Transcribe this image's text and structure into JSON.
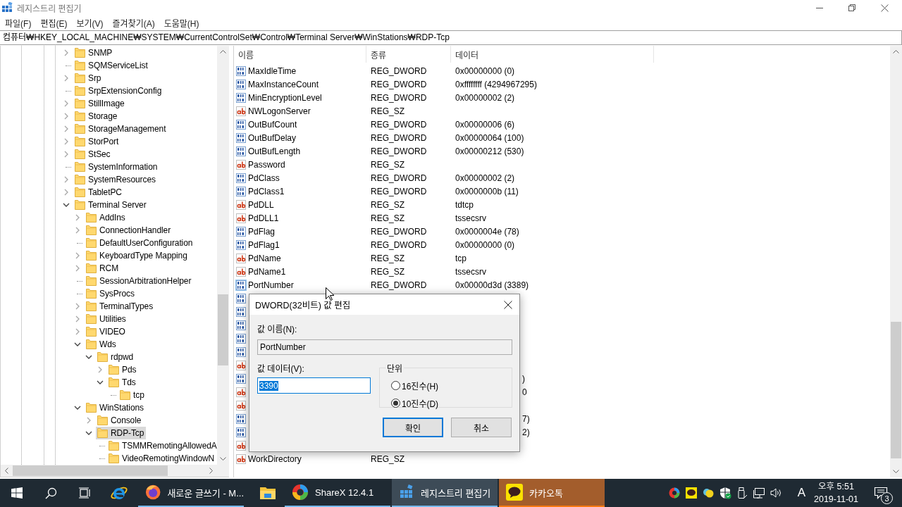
{
  "window": {
    "title": "레지스트리 편집기"
  },
  "menu": [
    "파일(F)",
    "편집(E)",
    "보기(V)",
    "즐겨찾기(A)",
    "도움말(H)"
  ],
  "address": "컴퓨터₩HKEY_LOCAL_MACHINE₩SYSTEM₩CurrentControlSet₩Control₩Terminal Server₩WinStations₩RDP-Tcp",
  "tree": [
    {
      "label": "SNMP",
      "kind": "branch",
      "expanded": false,
      "selected": false
    },
    {
      "label": "SQMServiceList",
      "kind": "leaf",
      "selected": false
    },
    {
      "label": "Srp",
      "kind": "branch",
      "expanded": false,
      "selected": false
    },
    {
      "label": "SrpExtensionConfig",
      "kind": "leaf",
      "selected": false
    },
    {
      "label": "StillImage",
      "kind": "branch",
      "expanded": false,
      "selected": false
    },
    {
      "label": "Storage",
      "kind": "branch",
      "expanded": false,
      "selected": false
    },
    {
      "label": "StorageManagement",
      "kind": "branch",
      "expanded": false,
      "selected": false
    },
    {
      "label": "StorPort",
      "kind": "branch",
      "expanded": false,
      "selected": false
    },
    {
      "label": "StSec",
      "kind": "branch",
      "expanded": false,
      "selected": false
    },
    {
      "label": "SystemInformation",
      "kind": "leaf",
      "selected": false
    },
    {
      "label": "SystemResources",
      "kind": "branch",
      "expanded": false,
      "selected": false
    },
    {
      "label": "TabletPC",
      "kind": "branch",
      "expanded": false,
      "selected": false
    },
    {
      "label": "Terminal Server",
      "kind": "branch",
      "expanded": true,
      "selected": false,
      "children": [
        {
          "label": "AddIns",
          "kind": "branch",
          "expanded": false,
          "selected": false
        },
        {
          "label": "ConnectionHandler",
          "kind": "branch",
          "expanded": false,
          "selected": false
        },
        {
          "label": "DefaultUserConfiguration",
          "kind": "leaf",
          "selected": false
        },
        {
          "label": "KeyboardType Mapping",
          "kind": "branch",
          "expanded": false,
          "selected": false
        },
        {
          "label": "RCM",
          "kind": "branch",
          "expanded": false,
          "selected": false
        },
        {
          "label": "SessionArbitrationHelper",
          "kind": "leaf",
          "selected": false
        },
        {
          "label": "SysProcs",
          "kind": "leaf",
          "selected": false
        },
        {
          "label": "TerminalTypes",
          "kind": "branch",
          "expanded": false,
          "selected": false
        },
        {
          "label": "Utilities",
          "kind": "branch",
          "expanded": false,
          "selected": false
        },
        {
          "label": "VIDEO",
          "kind": "branch",
          "expanded": false,
          "selected": false
        },
        {
          "label": "Wds",
          "kind": "branch",
          "expanded": true,
          "selected": false,
          "children": [
            {
              "label": "rdpwd",
              "kind": "branch",
              "expanded": true,
              "selected": false,
              "children": [
                {
                  "label": "Pds",
                  "kind": "branch",
                  "expanded": false,
                  "selected": false
                },
                {
                  "label": "Tds",
                  "kind": "branch",
                  "expanded": true,
                  "selected": false,
                  "children": [
                    {
                      "label": "tcp",
                      "kind": "leaf",
                      "selected": false
                    }
                  ]
                }
              ]
            }
          ]
        },
        {
          "label": "WinStations",
          "kind": "branch",
          "expanded": true,
          "selected": false,
          "children": [
            {
              "label": "Console",
              "kind": "branch",
              "expanded": false,
              "selected": false
            },
            {
              "label": "RDP-Tcp",
              "kind": "branch",
              "expanded": true,
              "selected": true,
              "children": [
                {
                  "label": "TSMMRemotingAllowedA",
                  "kind": "leaf",
                  "selected": false
                },
                {
                  "label": "VideoRemotingWindowN",
                  "kind": "leaf",
                  "selected": false
                }
              ]
            }
          ]
        }
      ]
    }
  ],
  "list": {
    "columns": [
      "이름",
      "종류",
      "데이터"
    ],
    "rows": [
      {
        "kind": "dword",
        "name": "MaxIdleTime",
        "type": "REG_DWORD",
        "data": "0x00000000 (0)",
        "selected": false
      },
      {
        "kind": "dword",
        "name": "MaxInstanceCount",
        "type": "REG_DWORD",
        "data": "0xffffffff (4294967295)",
        "selected": false
      },
      {
        "kind": "dword",
        "name": "MinEncryptionLevel",
        "type": "REG_DWORD",
        "data": "0x00000002 (2)",
        "selected": false
      },
      {
        "kind": "sz",
        "name": "NWLogonServer",
        "type": "REG_SZ",
        "selected": false
      },
      {
        "kind": "dword",
        "name": "OutBufCount",
        "type": "REG_DWORD",
        "data": "0x00000006 (6)",
        "selected": false
      },
      {
        "kind": "dword",
        "name": "OutBufDelay",
        "type": "REG_DWORD",
        "data": "0x00000064 (100)",
        "selected": false
      },
      {
        "kind": "dword",
        "name": "OutBufLength",
        "type": "REG_DWORD",
        "data": "0x00000212 (530)",
        "selected": false
      },
      {
        "kind": "sz",
        "name": "Password",
        "type": "REG_SZ",
        "selected": false
      },
      {
        "kind": "dword",
        "name": "PdClass",
        "type": "REG_DWORD",
        "data": "0x00000002 (2)",
        "selected": false
      },
      {
        "kind": "dword",
        "name": "PdClass1",
        "type": "REG_DWORD",
        "data": "0x0000000b (11)",
        "selected": false
      },
      {
        "kind": "sz",
        "name": "PdDLL",
        "type": "REG_SZ",
        "data": "tdtcp",
        "selected": false
      },
      {
        "kind": "sz",
        "name": "PdDLL1",
        "type": "REG_SZ",
        "data": "tssecsrv",
        "selected": false
      },
      {
        "kind": "dword",
        "name": "PdFlag",
        "type": "REG_DWORD",
        "data": "0x0000004e (78)",
        "selected": false
      },
      {
        "kind": "dword",
        "name": "PdFlag1",
        "type": "REG_DWORD",
        "data": "0x00000000 (0)",
        "selected": false
      },
      {
        "kind": "sz",
        "name": "PdName",
        "type": "REG_SZ",
        "data": "tcp",
        "selected": false
      },
      {
        "kind": "sz",
        "name": "PdName1",
        "type": "REG_SZ",
        "data": "tssecsrv",
        "selected": false
      },
      {
        "kind": "dword",
        "name": "PortNumber",
        "type": "REG_DWORD",
        "data": "0x00000d3d (3389)",
        "selected": true
      },
      {
        "kind": "dword",
        "selected": false
      },
      {
        "kind": "dword",
        "selected": false
      },
      {
        "kind": "dword",
        "selected": false
      },
      {
        "kind": "dword",
        "selected": false
      },
      {
        "kind": "dword",
        "selected": false
      },
      {
        "kind": "sz",
        "selected": false
      },
      {
        "kind": "dword",
        "data_tail": ")",
        "selected": false
      },
      {
        "kind": "sz",
        "data_tail": "0",
        "selected": false
      },
      {
        "kind": "sz",
        "selected": false
      },
      {
        "kind": "dword",
        "data_tail": "7)",
        "selected": false
      },
      {
        "kind": "dword",
        "data_tail": "2)",
        "selected": false
      },
      {
        "kind": "sz",
        "selected": false
      },
      {
        "kind": "sz",
        "name": "WorkDirectory",
        "type": "REG_SZ",
        "selected": false
      }
    ]
  },
  "dialog": {
    "title": "DWORD(32비트) 값 편집",
    "name_label": "값 이름(N):",
    "name_value": "PortNumber",
    "data_label": "값 데이터(V):",
    "data_value": "3390",
    "data_value_selected": true,
    "base_label": "단위",
    "base_options": [
      {
        "label": "16진수(H)",
        "selected": false
      },
      {
        "label": "10진수(D)",
        "selected": true
      }
    ],
    "buttons": [
      {
        "label": "확인",
        "default": true
      },
      {
        "label": "취소",
        "default": false
      }
    ]
  },
  "taskbar": {
    "items": [
      {
        "kind": "start"
      },
      {
        "kind": "search"
      },
      {
        "kind": "taskview"
      },
      {
        "kind": "ie",
        "running": false,
        "active": false,
        "attention": false
      },
      {
        "kind": "firefox",
        "label": "새로운 글쓰기 - M...",
        "running": true,
        "active": false,
        "attention": false
      },
      {
        "kind": "explorer",
        "running": false,
        "active": false,
        "attention": false
      },
      {
        "kind": "sharex",
        "label": "ShareX 12.4.1",
        "running": true,
        "active": false,
        "attention": false
      },
      {
        "kind": "regedit",
        "label": "레지스트리 편집기",
        "running": true,
        "active": true,
        "attention": false
      },
      {
        "kind": "kakao",
        "label": "카카오톡",
        "running": true,
        "active": false,
        "attention": true
      }
    ],
    "tray": [
      {
        "kind": "sharex"
      },
      {
        "kind": "kakao"
      },
      {
        "kind": "chat"
      },
      {
        "kind": "shield"
      },
      {
        "kind": "usb"
      },
      {
        "kind": "network"
      },
      {
        "kind": "volume"
      }
    ],
    "ime": "A",
    "time": "오후 5:51",
    "date": "2019-11-01",
    "notifications": "3"
  }
}
